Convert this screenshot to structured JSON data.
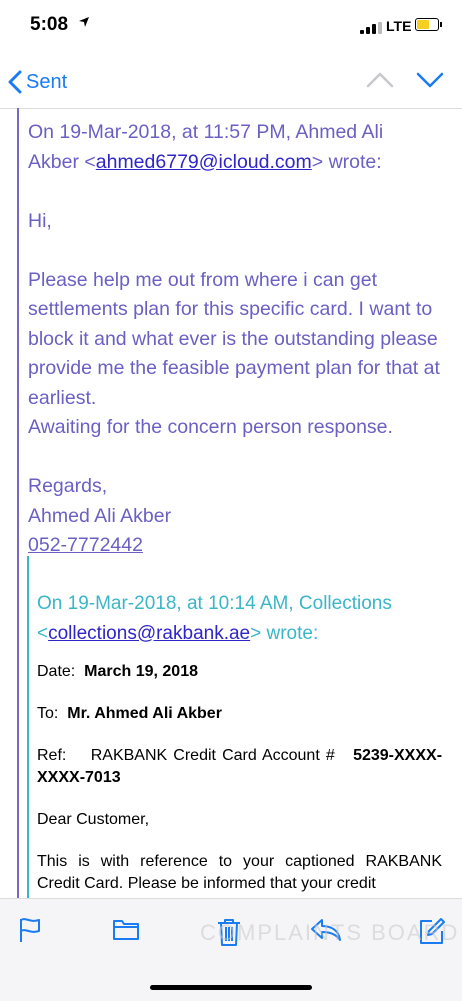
{
  "status": {
    "time": "5:08",
    "carrier": "LTE"
  },
  "nav": {
    "back_label": "Sent"
  },
  "quote1": {
    "header_a": "On 19-Mar-2018, at 11:57 PM, Ahmed Ali",
    "header_b": "Akber <",
    "email": "ahmed6779@icloud.com",
    "header_c": "> wrote:",
    "greeting": "Hi,",
    "body": "Please help me out from where i can get settlements plan for this specific card. I want to block it and what ever is the outstanding please provide me the feasible payment plan for that at earliest.",
    "body2": "Awaiting for the concern person response.",
    "regards": "Regards,",
    "name": "Ahmed Ali Akber",
    "phone": "052-7772442"
  },
  "quote2": {
    "header_a": "On 19-Mar-2018, at 10:14 AM, Collections",
    "header_b": "<",
    "email": "collections@rakbank.ae",
    "header_c": "> wrote:",
    "date_label": "Date:",
    "date_value": "March 19, 2018",
    "to_label": "To:",
    "to_value": "Mr. Ahmed Ali Akber",
    "ref_label": "Ref:",
    "ref_text": "RAKBANK Credit Card Account #",
    "ref_number": "5239-XXXX-XXXX-7013",
    "salutation": "Dear Customer,",
    "body": "This is with reference to your captioned RAKBANK Credit Card. Please be informed that your credit"
  },
  "watermark": "COMPLAINTS BOARD",
  "colors": {
    "accent": "#1a7cf0",
    "quote1": "#6b5fc4",
    "quote2": "#3ab6c8",
    "link": "#2f25c8"
  },
  "icons": [
    "location-arrow-icon",
    "signal-icon",
    "battery-icon",
    "chevron-left-icon",
    "chevron-up-icon",
    "chevron-down-icon",
    "flag-icon",
    "folder-icon",
    "trash-icon",
    "reply-icon",
    "compose-icon"
  ]
}
